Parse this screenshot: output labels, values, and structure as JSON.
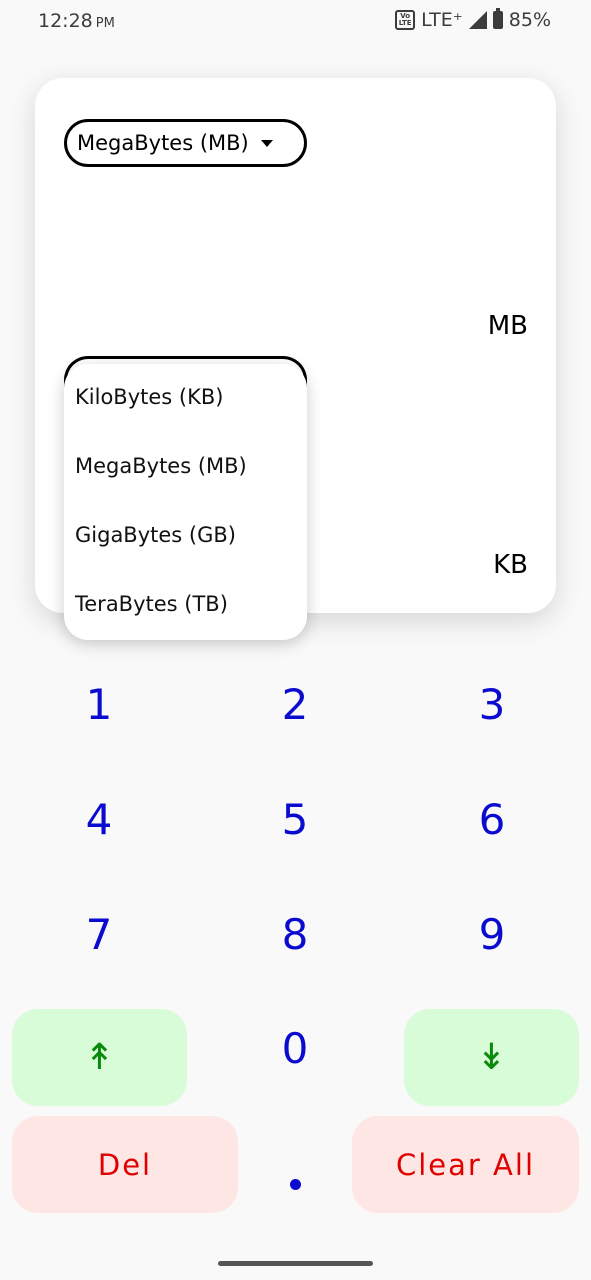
{
  "status_bar": {
    "time": "12:28",
    "ampm": "PM",
    "network": "LTE⁺",
    "battery": "85%"
  },
  "converter": {
    "from_unit": "MegaBytes (MB)",
    "from_unit_abbr": "MB",
    "to_unit_abbr": "KB"
  },
  "dropdown": {
    "options": [
      "KiloBytes (KB)",
      "MegaBytes (MB)",
      "GigaBytes (GB)",
      "TeraBytes (TB)"
    ]
  },
  "keypad": {
    "digits": [
      "1",
      "2",
      "3",
      "4",
      "5",
      "6",
      "7",
      "8",
      "9",
      "0"
    ],
    "up_label": "↟",
    "down_label": "↡",
    "del_label": "Del",
    "clear_label": "Clear All"
  }
}
